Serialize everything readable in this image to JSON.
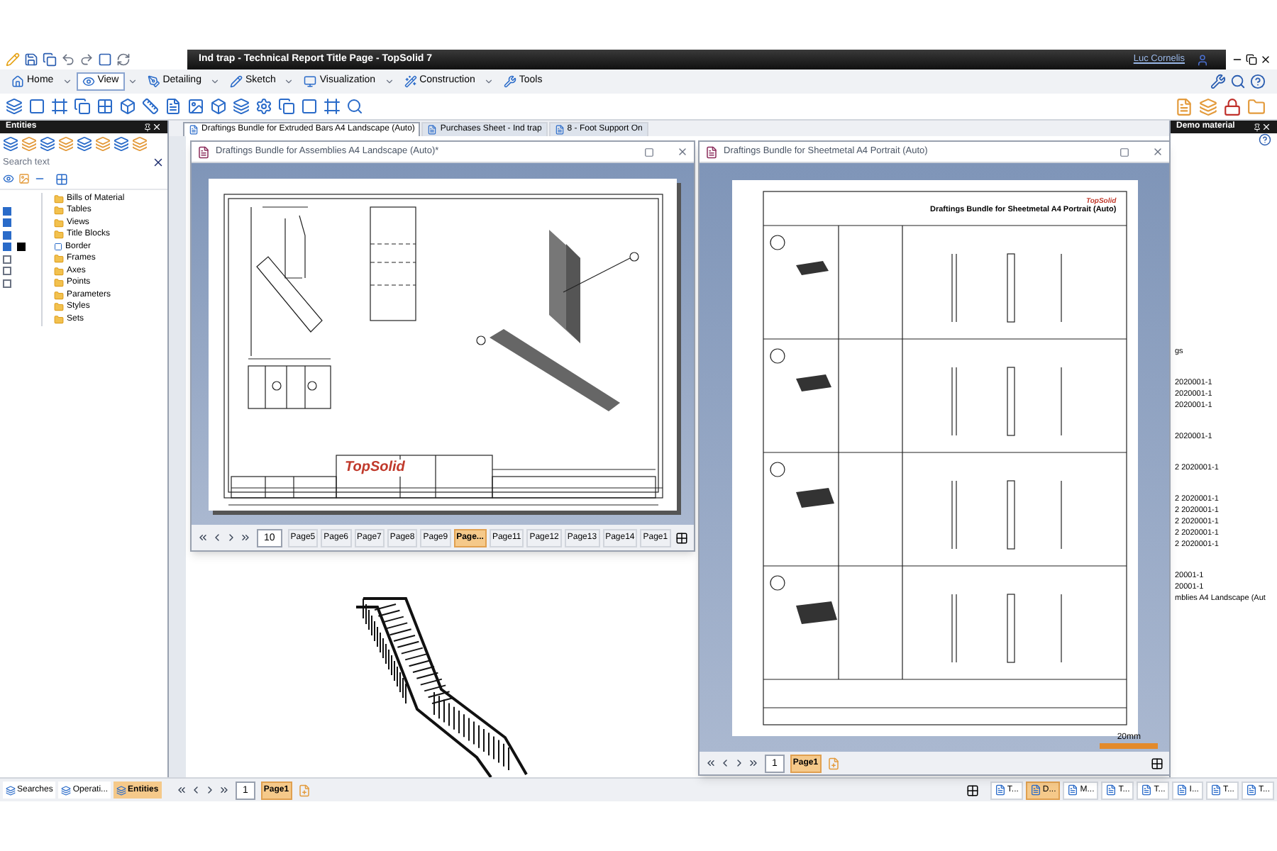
{
  "titlebar": {
    "title": "Ind trap - Technical Report Title Page - TopSolid 7",
    "user": "Luc Cornelis"
  },
  "ribbon_tabs": [
    {
      "label": "Home",
      "selected": false
    },
    {
      "label": "View",
      "selected": true
    },
    {
      "label": "Detailing",
      "selected": false
    },
    {
      "label": "Sketch",
      "selected": false
    },
    {
      "label": "Visualization",
      "selected": false
    },
    {
      "label": "Construction",
      "selected": false
    },
    {
      "label": "Tools",
      "selected": false
    }
  ],
  "entities_panel": {
    "title": "Entities",
    "search": {
      "placeholder": "Search text"
    },
    "tree": [
      {
        "label": "Bills of Material",
        "kind": "folder"
      },
      {
        "label": "Tables",
        "kind": "folder",
        "checked": true
      },
      {
        "label": "Views",
        "kind": "folder",
        "checked": true
      },
      {
        "label": "Title Blocks",
        "kind": "folder",
        "checked": true
      },
      {
        "label": "Border",
        "kind": "item",
        "checked": true,
        "color": "#000000"
      },
      {
        "label": "Frames",
        "kind": "folder",
        "checked": false
      },
      {
        "label": "Axes",
        "kind": "folder",
        "checked": false
      },
      {
        "label": "Points",
        "kind": "folder",
        "checked": false
      },
      {
        "label": "Parameters",
        "kind": "folder"
      },
      {
        "label": "Styles",
        "kind": "folder"
      },
      {
        "label": "Sets",
        "kind": "folder"
      }
    ]
  },
  "document_tabs": [
    {
      "label": "Draftings Bundle for Extruded Bars A4 Landscape (Auto)",
      "selected": true
    },
    {
      "label": "Purchases Sheet - Ind trap",
      "selected": false
    },
    {
      "label": "8 - Foot Support On",
      "selected": false
    }
  ],
  "assemblies_window": {
    "title": "Draftings Bundle for Assemblies A4 Landscape (Auto)*",
    "logo": "TopSolid",
    "page_number": "10",
    "pages": [
      {
        "label": "Page5",
        "selected": false
      },
      {
        "label": "Page6",
        "selected": false
      },
      {
        "label": "Page7",
        "selected": false
      },
      {
        "label": "Page8",
        "selected": false
      },
      {
        "label": "Page9",
        "selected": false
      },
      {
        "label": "Page...",
        "selected": true
      },
      {
        "label": "Page11",
        "selected": false
      },
      {
        "label": "Page12",
        "selected": false
      },
      {
        "label": "Page13",
        "selected": false
      },
      {
        "label": "Page14",
        "selected": false
      },
      {
        "label": "Page1",
        "selected": false
      }
    ]
  },
  "sheetmetal_window": {
    "title": "Draftings Bundle for Sheetmetal A4 Portrait (Auto)",
    "sheet_title": "Draftings Bundle for Sheetmetal A4 Portrait (Auto)",
    "logo": "TopSolid",
    "scale": "20mm",
    "page_number": "1",
    "pages": [
      {
        "label": "Page1",
        "selected": true
      }
    ]
  },
  "base_document": {
    "page_number": "1",
    "pages": [
      {
        "label": "Page1",
        "selected": true
      }
    ]
  },
  "demo_panel": {
    "title": "Demo material",
    "groups": [
      [
        "gs"
      ],
      [
        "2020001-1",
        "2020001-1",
        "2020001-1"
      ],
      [
        "2020001-1"
      ],
      [
        "2 2020001-1"
      ],
      [
        "2 2020001-1",
        "2 2020001-1",
        "2 2020001-1",
        "2 2020001-1",
        "2 2020001-1"
      ],
      [
        "20001-1",
        "20001-1",
        "mblies A4 Landscape (Aut"
      ]
    ]
  },
  "bottom_tabs": [
    {
      "label": "Searches",
      "selected": false
    },
    {
      "label": "Operati...",
      "selected": false
    },
    {
      "label": "Entities",
      "selected": true
    }
  ],
  "taskbar": [
    {
      "label": "T...",
      "selected": false
    },
    {
      "label": "D...",
      "selected": true
    },
    {
      "label": "M...",
      "selected": false
    },
    {
      "label": "T...",
      "selected": false
    },
    {
      "label": "T...",
      "selected": false
    },
    {
      "label": "I...",
      "selected": false
    },
    {
      "label": "T...",
      "selected": false
    },
    {
      "label": "T...",
      "selected": false
    }
  ]
}
